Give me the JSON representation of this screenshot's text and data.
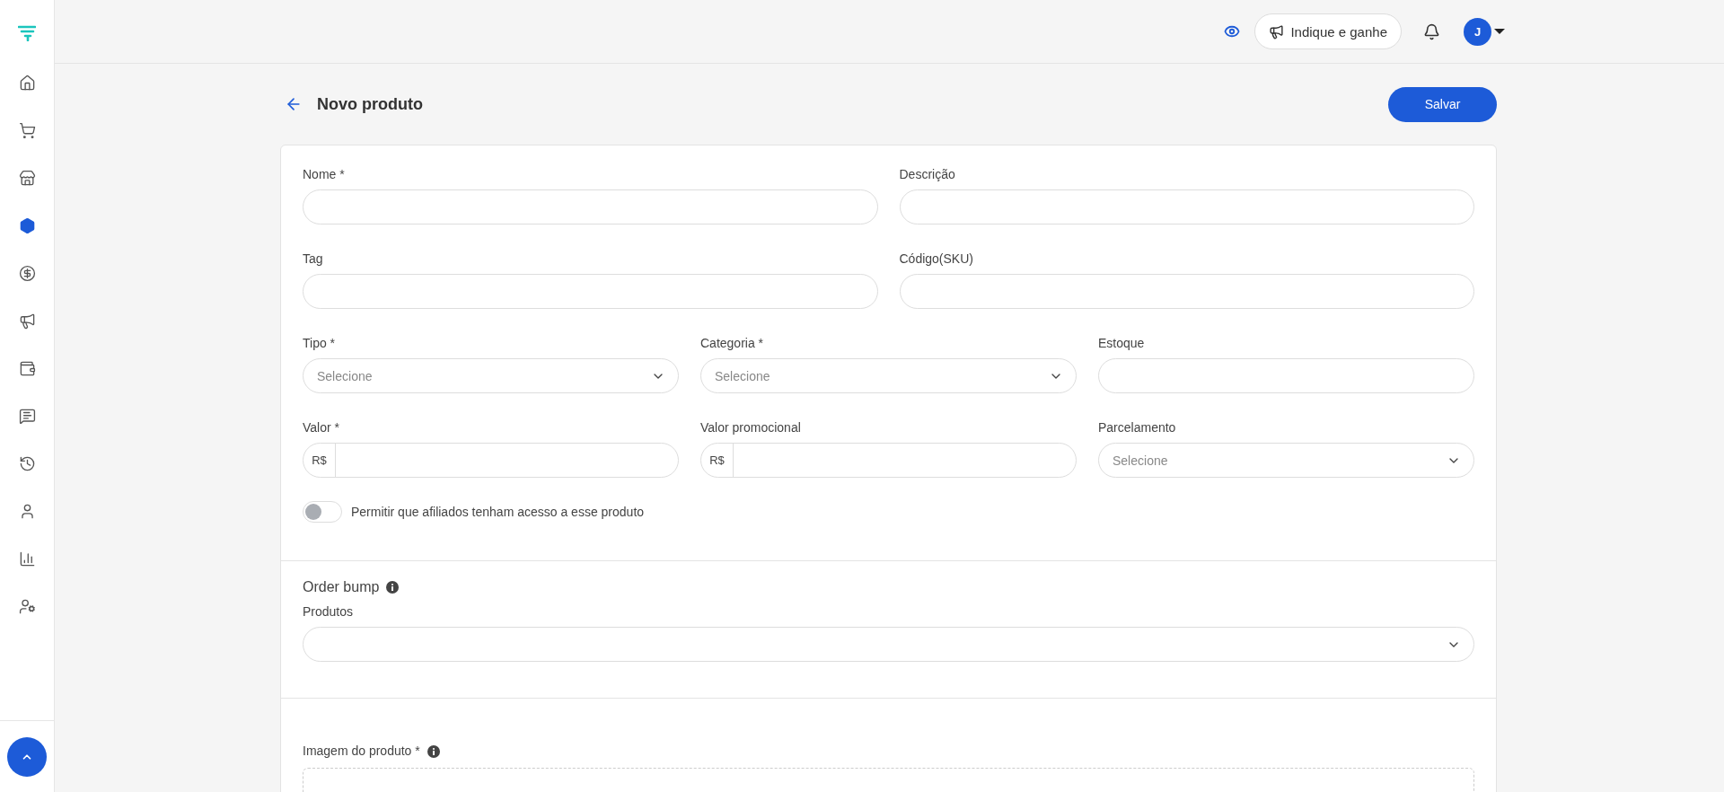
{
  "sidebar": {
    "items": [
      {
        "selected": false
      },
      {
        "selected": false
      },
      {
        "selected": false
      },
      {
        "selected": true
      },
      {
        "selected": false
      },
      {
        "selected": false
      },
      {
        "selected": false
      },
      {
        "selected": false
      },
      {
        "selected": false
      },
      {
        "selected": false
      },
      {
        "selected": false
      },
      {
        "selected": false
      }
    ]
  },
  "topbar": {
    "referral_button": "Indique e ganhe",
    "avatar": "J"
  },
  "header": {
    "title": "Novo produto",
    "save_button": "Salvar"
  },
  "form": {
    "rows": [
      {
        "fields": [
          {
            "kind": "text",
            "label": "Nome *"
          },
          {
            "kind": "text",
            "label": "Descrição"
          }
        ]
      },
      {
        "fields": [
          {
            "kind": "text",
            "label": "Tag"
          },
          {
            "kind": "text",
            "label": "Código(SKU)"
          }
        ]
      },
      {
        "fields": [
          {
            "kind": "select",
            "label": "Tipo *",
            "placeholder": "Selecione"
          },
          {
            "kind": "select",
            "label": "Categoria *",
            "placeholder": "Selecione"
          },
          {
            "kind": "text",
            "label": "Estoque"
          }
        ]
      },
      {
        "fields": [
          {
            "kind": "currency",
            "label": "Valor *",
            "prefix": "R$"
          },
          {
            "kind": "currency",
            "label": "Valor promocional",
            "prefix": "R$"
          },
          {
            "kind": "select",
            "label": "Parcelamento",
            "placeholder": "Selecione"
          }
        ]
      }
    ],
    "affiliate_toggle": {
      "label": "Permitir que afiliados tenham acesso a esse produto",
      "on": false
    }
  },
  "order_bump": {
    "title": "Order bump",
    "products_label": "Produtos"
  },
  "image_section": {
    "label": "Imagem do produto *"
  }
}
